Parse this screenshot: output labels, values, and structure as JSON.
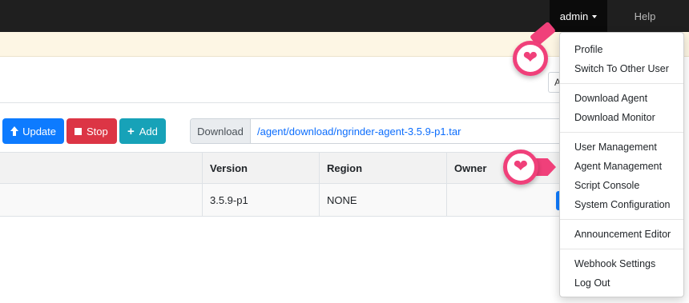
{
  "navbar": {
    "user_menu_label": "admin",
    "help_label": "Help"
  },
  "partial_select_text": "A",
  "toolbar": {
    "update_label": "Update",
    "stop_label": "Stop",
    "add_label": "Add",
    "download_label": "Download",
    "download_link": "/agent/download/ngrinder-agent-3.5.9-p1.tar"
  },
  "table": {
    "headers": [
      "Version",
      "Region",
      "Owner"
    ],
    "rows": [
      {
        "version": "3.5.9-p1",
        "region": "NONE",
        "owner": ""
      }
    ]
  },
  "dropdown": {
    "groups": [
      [
        "Profile",
        "Switch To Other User"
      ],
      [
        "Download Agent",
        "Download Monitor"
      ],
      [
        "User Management",
        "Agent Management",
        "Script Console",
        "System Configuration"
      ],
      [
        "Announcement Editor"
      ],
      [
        "Webhook Settings",
        "Log Out"
      ]
    ]
  },
  "callouts": [
    {
      "target": "admin",
      "icon": "heart-icon"
    },
    {
      "target": "Agent Management",
      "icon": "heart-icon"
    }
  ],
  "colors": {
    "navbar": "#1f1f1f",
    "update_button": "#0d7bff",
    "stop_button": "#dc3545",
    "add_button": "#17a2b8",
    "link": "#0d6efd",
    "callout": "#f0407a",
    "notice": "#fdf6e4"
  }
}
